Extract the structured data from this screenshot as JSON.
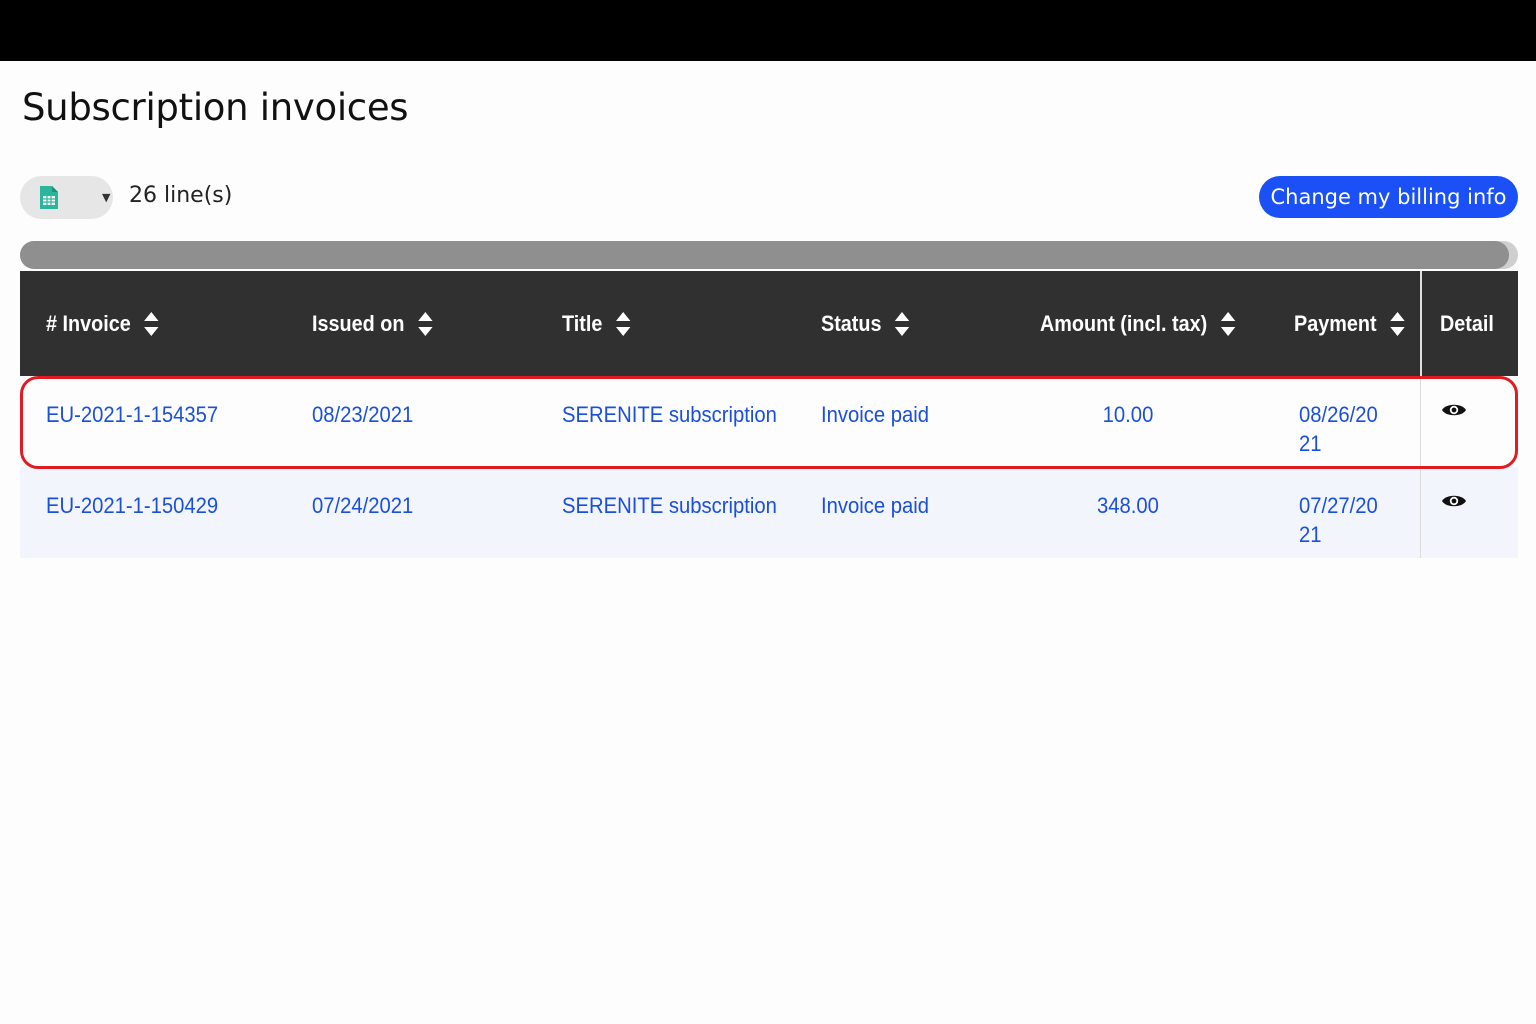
{
  "page": {
    "title": "Subscription invoices"
  },
  "toolbar": {
    "export_icon": "spreadsheet-icon",
    "caret": "▼",
    "line_count": "26 line(s)",
    "billing_button": "Change my billing info"
  },
  "table": {
    "headers": {
      "invoice": "# Invoice",
      "issued": "Issued on",
      "title": "Title",
      "status": "Status",
      "amount": "Amount (incl. tax)",
      "payment": "Payment",
      "detail": "Detail"
    },
    "rows": [
      {
        "invoice": "EU-2021-1-154357",
        "issued": "08/23/2021",
        "title": "SERENITE subscription",
        "status": "Invoice paid",
        "amount": "10.00",
        "payment": "08/26/2021"
      },
      {
        "invoice": "EU-2021-1-150429",
        "issued": "07/24/2021",
        "title": "SERENITE subscription",
        "status": "Invoice paid",
        "amount": "348.00",
        "payment": "07/27/2021"
      }
    ]
  },
  "colors": {
    "header_bg": "#303030",
    "link": "#1a4fdc",
    "button": "#1a50f5",
    "highlight": "#e01b22"
  }
}
